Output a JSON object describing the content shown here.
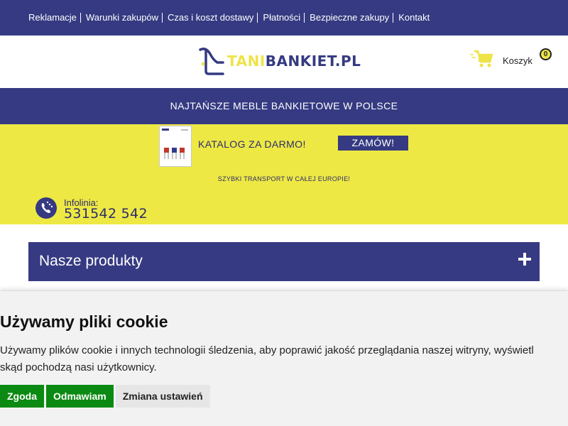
{
  "top_nav": {
    "items": [
      {
        "label": "Reklamacje"
      },
      {
        "label": "Warunki zakupów"
      },
      {
        "label": "Czas i koszt dostawy"
      },
      {
        "label": "Płatności"
      },
      {
        "label": "Bezpieczne zakupy"
      },
      {
        "label": "Kontakt"
      }
    ]
  },
  "header": {
    "logo_part1": "TANI",
    "logo_part2": "BANKIET.PL",
    "cart_label": "Koszyk",
    "cart_count": "0"
  },
  "banner": {
    "text": "NAJTAŃSZE MEBLE BANKIETOWE W POLSCE"
  },
  "promo": {
    "catalog_text": "KATALOG ZA DARMO!",
    "order_button": "ZAMÓW!",
    "transport_text": "SZYBKI TRANSPORT W CAŁEJ EUROPIE!",
    "info_label": "Infolinia:",
    "info_number": "531542 542"
  },
  "products": {
    "title": "Nasze produkty"
  },
  "cookie": {
    "title": "Używamy pliki cookie",
    "text_line1": "Używamy plików cookie i innych technologii śledzenia, aby poprawić jakość przeglądania naszej witryny, wyświetl",
    "text_line2": "skąd pochodzą nasi użytkownicy.",
    "accept": "Zgoda",
    "reject": "Odmawiam",
    "settings": "Zmiana ustawień"
  },
  "colors": {
    "brand_blue": "#353a82",
    "brand_yellow": "#ede844",
    "cookie_green": "#0a8a12"
  }
}
